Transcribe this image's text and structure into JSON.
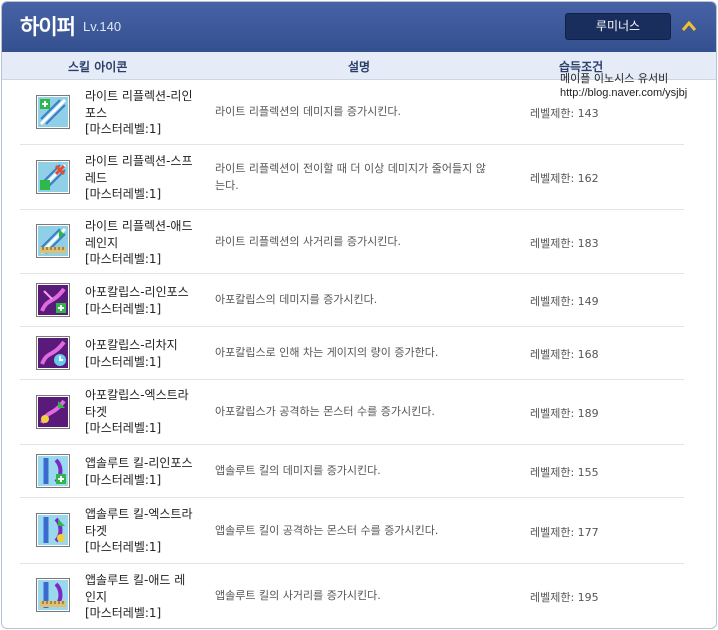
{
  "header": {
    "title": "하이퍼",
    "level": "Lv.140",
    "lumi_button": "루미너스"
  },
  "columns": {
    "icon": "스킬 아이콘",
    "description": "설명",
    "condition": "습득조건"
  },
  "watermark": {
    "line1": "메이플 이노시스 유서비",
    "line2": "http://blog.naver.com/ysjbj"
  },
  "skills": [
    {
      "name_1": "라이트 리플렉션-리인",
      "name_2": "포스",
      "name_3": "[마스터레벨:1]",
      "desc_1": "라이트 리플렉션의 데미지를 증가시킨다.",
      "desc_2": "",
      "condition": "레벨제한: 143",
      "icon": "light-reflection-reinforce-icon"
    },
    {
      "name_1": "라이트 리플렉션-스프",
      "name_2": "레드",
      "name_3": "[마스터레벨:1]",
      "desc_1": "라이트 리플렉션이 전이할 때 더 이상 데미지가 줄어들지 않",
      "desc_2": "는다.",
      "condition": "레벨제한: 162",
      "icon": "light-reflection-spread-icon"
    },
    {
      "name_1": "라이트 리플렉션-애드",
      "name_2": "레인지",
      "name_3": "[마스터레벨:1]",
      "desc_1": "라이트 리플렉션의 사거리를 증가시킨다.",
      "desc_2": "",
      "condition": "레벨제한: 183",
      "icon": "light-reflection-add-range-icon"
    },
    {
      "name_1": "아포칼립스-리인포스",
      "name_2": "[마스터레벨:1]",
      "name_3": "",
      "desc_1": "아포칼립스의 데미지를 증가시킨다.",
      "desc_2": "",
      "condition": "레벨제한: 149",
      "icon": "apocalypse-reinforce-icon"
    },
    {
      "name_1": "아포칼립스-리차지",
      "name_2": "[마스터레벨:1]",
      "name_3": "",
      "desc_1": "아포칼립스로 인해 차는 게이지의 량이 증가한다.",
      "desc_2": "",
      "condition": "레벨제한: 168",
      "icon": "apocalypse-recharge-icon"
    },
    {
      "name_1": "아포칼립스-엑스트라",
      "name_2": "타겟",
      "name_3": "[마스터레벨:1]",
      "desc_1": "아포칼립스가 공격하는 몬스터 수를 증가시킨다.",
      "desc_2": "",
      "condition": "레벨제한: 189",
      "icon": "apocalypse-extra-target-icon"
    },
    {
      "name_1": "앱솔루트 킬-리인포스",
      "name_2": "[마스터레벨:1]",
      "name_3": "",
      "desc_1": "앱솔루트 킬의 데미지를 증가시킨다.",
      "desc_2": "",
      "condition": "레벨제한: 155",
      "icon": "absolute-kill-reinforce-icon"
    },
    {
      "name_1": "앱솔루트 킬-엑스트라",
      "name_2": "타겟",
      "name_3": "[마스터레벨:1]",
      "desc_1": "앱솔루트 킬이 공격하는 몬스터 수를 증가시킨다.",
      "desc_2": "",
      "condition": "레벨제한: 177",
      "icon": "absolute-kill-extra-target-icon"
    },
    {
      "name_1": "앱솔루트 킬-애드 레",
      "name_2": "인지",
      "name_3": "[마스터레벨:1]",
      "desc_1": "앱솔루트 킬의 사거리를 증가시킨다.",
      "desc_2": "",
      "condition": "레벨제한: 195",
      "icon": "absolute-kill-add-range-icon"
    }
  ]
}
